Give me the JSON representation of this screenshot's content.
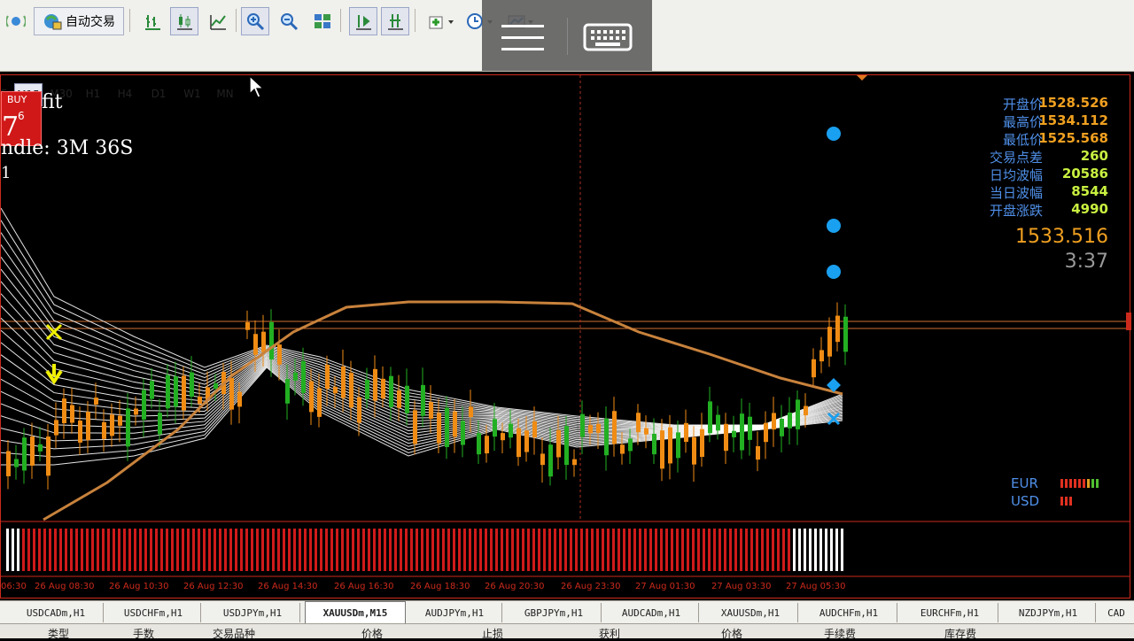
{
  "toolbar": {
    "autotrade_label": "自动交易",
    "timeframes": [
      "M15",
      "M30",
      "H1",
      "H4",
      "D1",
      "W1",
      "MN"
    ],
    "active_timeframe": "M15"
  },
  "chart_info": {
    "buy_label": "BUY",
    "buy_price_big": "7",
    "buy_price_small": "6",
    "profit_text": "fit",
    "candle_timer": "ndle: 3M 36S",
    "extra_line": "1"
  },
  "panel": {
    "rows": [
      {
        "label": "开盘价",
        "value": "1528.526",
        "color": "#f0a020"
      },
      {
        "label": "最高价",
        "value": "1534.112",
        "color": "#f0a020"
      },
      {
        "label": "最低价",
        "value": "1525.568",
        "color": "#f0a020"
      },
      {
        "label": "交易点差",
        "value": "260",
        "color": "#c8f040"
      },
      {
        "label": "日均波幅",
        "value": "20586",
        "color": "#c8f040"
      },
      {
        "label": "当日波幅",
        "value": "8544",
        "color": "#c8f040"
      },
      {
        "label": "开盘涨跌",
        "value": "4990",
        "color": "#c8f040"
      }
    ],
    "price": "1533.516",
    "countdown": "3:37"
  },
  "currency_strength": [
    {
      "label": "EUR",
      "bars": 9
    },
    {
      "label": "USD",
      "bars": 3
    }
  ],
  "time_axis": [
    "06:30",
    "26 Aug 08:30",
    "26 Aug 10:30",
    "26 Aug 12:30",
    "26 Aug 14:30",
    "26 Aug 16:30",
    "26 Aug 18:30",
    "26 Aug 20:30",
    "26 Aug 23:30",
    "27 Aug 01:30",
    "27 Aug 03:30",
    "27 Aug 05:30"
  ],
  "tabs": [
    "USDCADm,H1",
    "USDCHFm,H1",
    "USDJPYm,H1",
    "XAUUSDm,M15",
    "AUDJPYm,H1",
    "GBPJPYm,H1",
    "AUDCADm,H1",
    "XAUUSDm,H1",
    "AUDCHFm,H1",
    "EURCHFm,H1",
    "NZDJPYm,H1",
    "CAD"
  ],
  "active_tab": "XAUUSDm,M15",
  "columns": [
    "类型",
    "手数",
    "交易品种",
    "价格",
    "止损",
    "获利",
    "价格",
    "手续费",
    "库存费"
  ],
  "colors": {
    "bull": "#22b022",
    "bear": "#f08c14",
    "ma": "#c8823c",
    "accent_red": "#cc2a1c"
  }
}
